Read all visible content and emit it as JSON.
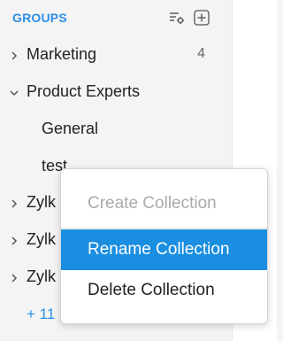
{
  "header": {
    "title": "GROUPS",
    "settings_icon": "sort-settings-icon",
    "add_icon": "add-square-icon"
  },
  "groups": [
    {
      "label": "Marketing",
      "count": "4",
      "expanded": false
    },
    {
      "label": "Product Experts",
      "expanded": true
    },
    {
      "label": "General",
      "child": true
    },
    {
      "label": "test",
      "child": true
    },
    {
      "label": "Zylk",
      "expanded": false
    },
    {
      "label": "Zylk",
      "expanded": false
    },
    {
      "label": "Zylk",
      "expanded": false
    }
  ],
  "more_link": "+ 11",
  "context_menu": {
    "items": [
      {
        "label": "Create Collection",
        "state": "disabled"
      },
      {
        "label": "Rename Collection",
        "state": "active"
      },
      {
        "label": "Delete Collection",
        "state": "normal"
      }
    ]
  },
  "colors": {
    "accent": "#2d8ee6",
    "menu_highlight": "#1a8ee0",
    "sidebar_bg": "#f4f4f4"
  }
}
